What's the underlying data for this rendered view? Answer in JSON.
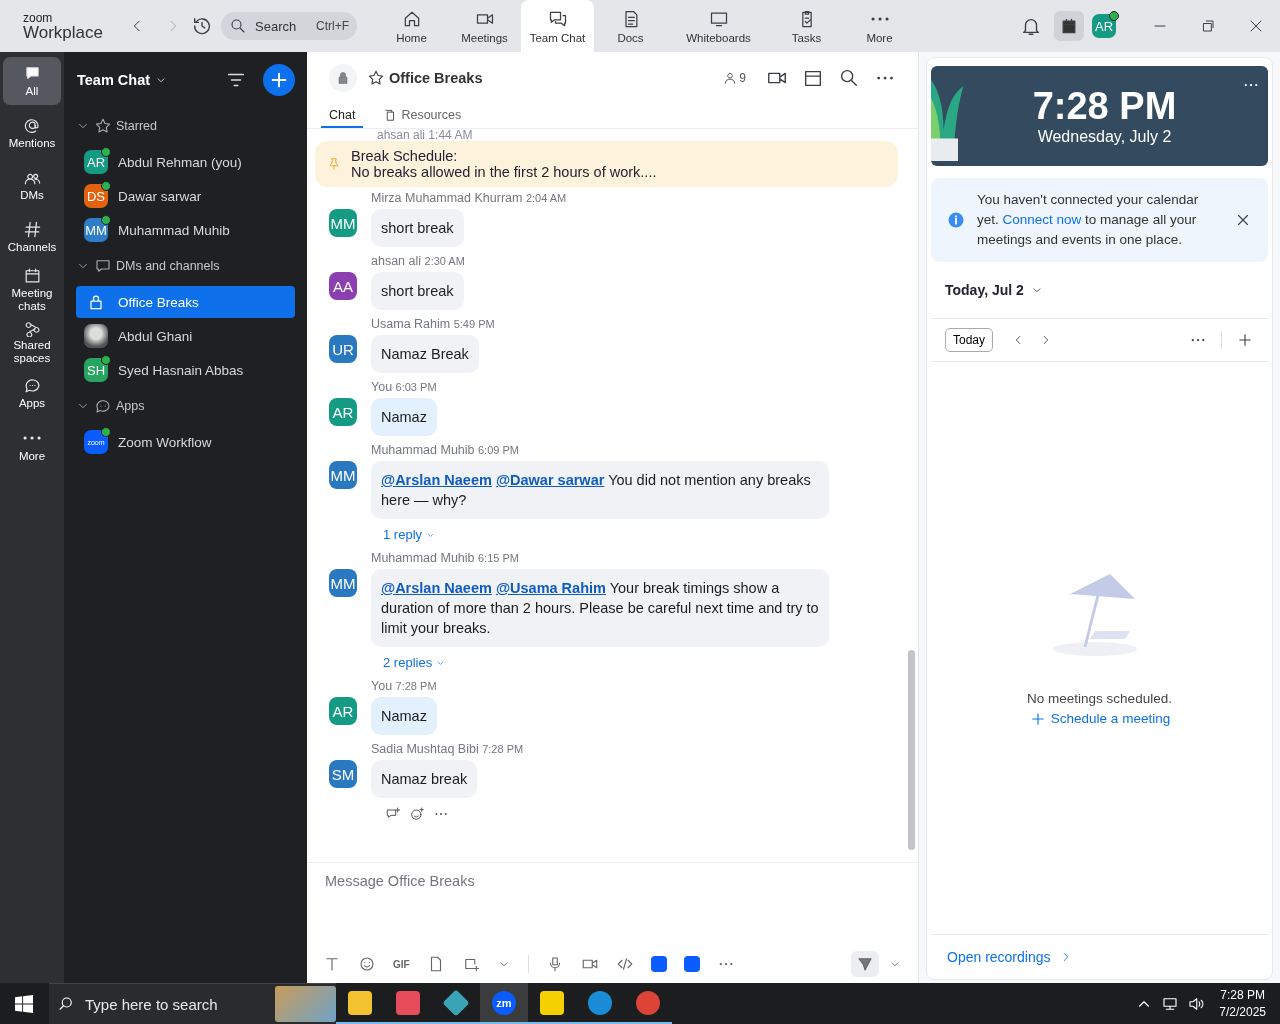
{
  "logo": {
    "small": "zoom",
    "large": "Workplace"
  },
  "search": {
    "placeholder": "Search",
    "shortcut": "Ctrl+F"
  },
  "nav_tabs": [
    {
      "label": "Home",
      "selected": false
    },
    {
      "label": "Meetings",
      "selected": false
    },
    {
      "label": "Team Chat",
      "selected": true
    },
    {
      "label": "Docs",
      "selected": false
    },
    {
      "label": "Whiteboards",
      "selected": false
    },
    {
      "label": "Tasks",
      "selected": false
    },
    {
      "label": "More",
      "selected": false
    }
  ],
  "profile": {
    "initials": "AR",
    "online": true
  },
  "rail": [
    {
      "label": "All",
      "selected": true
    },
    {
      "label": "Mentions",
      "selected": false
    },
    {
      "label": "DMs",
      "selected": false
    },
    {
      "label": "Channels",
      "selected": false
    },
    {
      "label": "Meeting chats",
      "selected": false
    },
    {
      "label": "Shared spaces",
      "selected": false
    },
    {
      "label": "Apps",
      "selected": false
    },
    {
      "label": "More",
      "selected": false
    }
  ],
  "sidebar": {
    "title": "Team Chat",
    "sections": [
      {
        "label": "Starred",
        "expanded": true,
        "items": [
          {
            "kind": "person",
            "name": "Abdul Rehman (you)",
            "initials": "AR",
            "color": "#159b83",
            "online": true,
            "selected": false
          },
          {
            "kind": "person",
            "name": "Dawar sarwar",
            "initials": "DS",
            "color": "#e2620f",
            "online": true,
            "selected": false
          },
          {
            "kind": "person",
            "name": "Muhammad Muhib",
            "initials": "MM",
            "color": "#2d7dc8",
            "online": true,
            "selected": false
          }
        ]
      },
      {
        "label": "DMs and channels",
        "expanded": true,
        "items": [
          {
            "kind": "channel",
            "name": "Office Breaks",
            "selected": true
          },
          {
            "kind": "photo",
            "name": "Abdul Ghani",
            "selected": false
          },
          {
            "kind": "person",
            "name": "Syed Hasnain Abbas",
            "initials": "SH",
            "color": "#25a560",
            "online": true,
            "selected": false
          }
        ]
      },
      {
        "label": "Apps",
        "expanded": true,
        "items": [
          {
            "kind": "app",
            "name": "Zoom Workflow",
            "badge": "zoom",
            "online": true,
            "selected": false
          }
        ]
      }
    ]
  },
  "chat": {
    "title": "Office Breaks",
    "member_count": "9",
    "tabs": [
      {
        "label": "Chat",
        "selected": true
      },
      {
        "label": "Resources",
        "selected": false
      }
    ],
    "cut_line": "ahsan ali 1:44 AM",
    "pinned": {
      "title": "Break Schedule:",
      "text": "No breaks allowed in the first 2 hours of work...."
    },
    "messages": [
      {
        "sender": "Mirza Muhammad Khurram",
        "time": "2:04 AM",
        "initials": "MM",
        "color": "#159b83",
        "own": false,
        "text": "short break"
      },
      {
        "sender": "ahsan ali",
        "time": "2:30 AM",
        "initials": "AA",
        "color": "#8b3fb0",
        "own": false,
        "text": "short break"
      },
      {
        "sender": "Usama Rahim",
        "time": "5:49 PM",
        "initials": "UR",
        "color": "#2a78bf",
        "own": false,
        "text": "Namaz Break"
      },
      {
        "sender": "You",
        "time": "6:03 PM",
        "initials": "AR",
        "color": "#159b83",
        "own": true,
        "text": "Namaz"
      },
      {
        "sender": "Muhammad Muhib",
        "time": "6:09 PM",
        "initials": "MM",
        "color": "#2a78bf",
        "own": false,
        "mentions": [
          "@Arslan Naeem",
          "@Dawar sarwar"
        ],
        "text": "You did not mention any breaks here — why?",
        "replies": "1 reply"
      },
      {
        "sender": "Muhammad Muhib",
        "time": "6:15 PM",
        "initials": "MM",
        "color": "#2a78bf",
        "own": false,
        "mentions": [
          "@Arslan Naeem",
          "@Usama Rahim"
        ],
        "text": "Your break timings show a duration of more than 2 hours. Please be careful next time and try to limit your breaks.",
        "replies": "2 replies"
      },
      {
        "sender": "You",
        "time": "7:28 PM",
        "initials": "AR",
        "color": "#159b83",
        "own": true,
        "text": "Namaz"
      },
      {
        "sender": "Sadia Mushtaq Bibi",
        "time": "7:28 PM",
        "initials": "SM",
        "color": "#2a78bf",
        "own": false,
        "text": "Namaz break"
      }
    ],
    "composer": {
      "placeholder": "Message Office Breaks",
      "gif": "GIF"
    }
  },
  "panel": {
    "time": "7:28 PM",
    "date": "Wednesday, July 2",
    "notice": {
      "before": "You haven't connected your calendar yet.",
      "link": "Connect now",
      "after": "to manage all your meetings and events in one place."
    },
    "day_label": "Today, Jul 2",
    "today_button": "Today",
    "empty": "No meetings scheduled.",
    "schedule": "Schedule a meeting",
    "recordings": "Open recordings"
  },
  "taskbar": {
    "search_placeholder": "Type here to search",
    "apps": [
      {
        "kind": "folder",
        "selected": false
      },
      {
        "kind": "snip",
        "selected": false
      },
      {
        "kind": "diamond",
        "selected": false
      },
      {
        "kind": "zoom",
        "label": "zm",
        "selected": true
      },
      {
        "kind": "notes",
        "selected": false
      },
      {
        "kind": "edge",
        "selected": false
      },
      {
        "kind": "chrome",
        "selected": false
      }
    ],
    "time": "7:28 PM",
    "date": "7/2/2025"
  }
}
